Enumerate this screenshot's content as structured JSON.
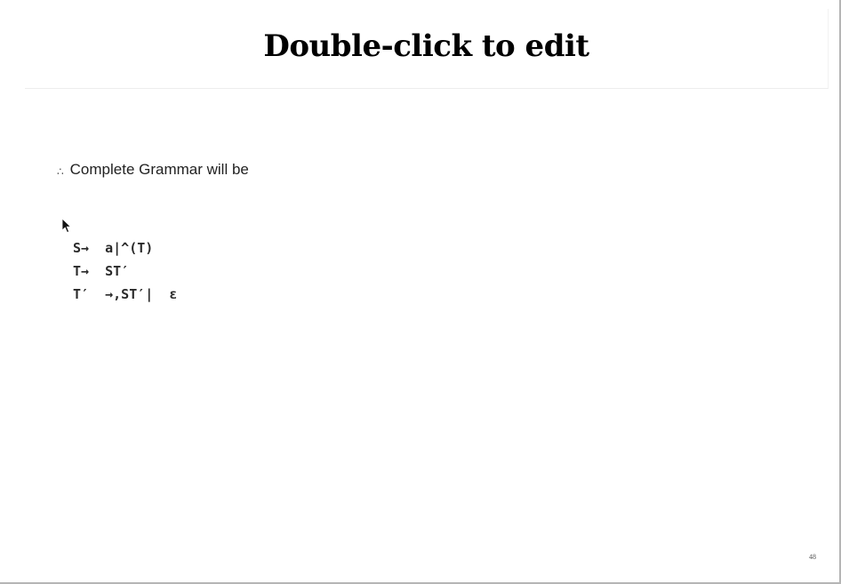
{
  "slide": {
    "title": "Double-click to edit",
    "bullet": {
      "symbol": "∴",
      "text": "Complete Grammar will be"
    },
    "grammar_rules": [
      "S→  a|^(T)",
      "T→  ST′",
      "T′  →,ST′|  ε"
    ],
    "page_number": "48"
  },
  "icons": {
    "cursor": "mouse-pointer-icon"
  }
}
